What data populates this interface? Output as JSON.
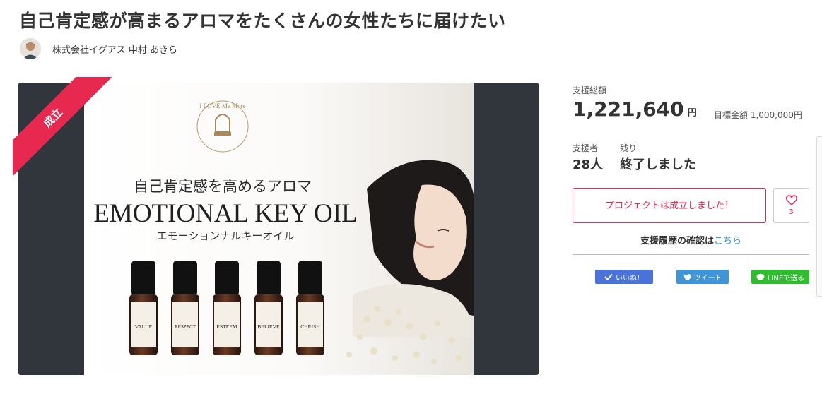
{
  "project": {
    "title": "自己肯定感が高まるアロマをたくさんの女性たちに届けたい",
    "author": "株式会社イグアス 中村 あきら",
    "status_badge": "成立"
  },
  "hero": {
    "brand_text": "I LOVE Me More",
    "headline": "自己肯定感を高めるアロマ",
    "product_name": "EMOTIONAL KEY OIL",
    "product_name_kana": "エモーションナルキーオイル",
    "bottles": [
      "VALUE",
      "RESPECT",
      "ESTEEM",
      "BELIEVE",
      "CHRISH"
    ]
  },
  "stats": {
    "total_label": "支援総額",
    "total_value": "1,221,640",
    "yen": "円",
    "goal_text": "目標金額 1,000,000円",
    "backers_label": "支援者",
    "backers_value": "28人",
    "remaining_label": "残り",
    "remaining_value": "終了しました"
  },
  "actions": {
    "main_button": "プロジェクトは成立しました！",
    "like_count": "3",
    "history_text": "支援履歴の確認は",
    "history_link": "こちら"
  },
  "social": {
    "facebook": "いいね！",
    "twitter": "ツイート",
    "line": "LINEで送る"
  },
  "colors": {
    "accent": "#e8294f",
    "link": "#2a9ad6",
    "facebook": "#4b72d8",
    "twitter": "#3f95d8",
    "line": "#2fbd2f",
    "hero_bg": "#31363d"
  }
}
